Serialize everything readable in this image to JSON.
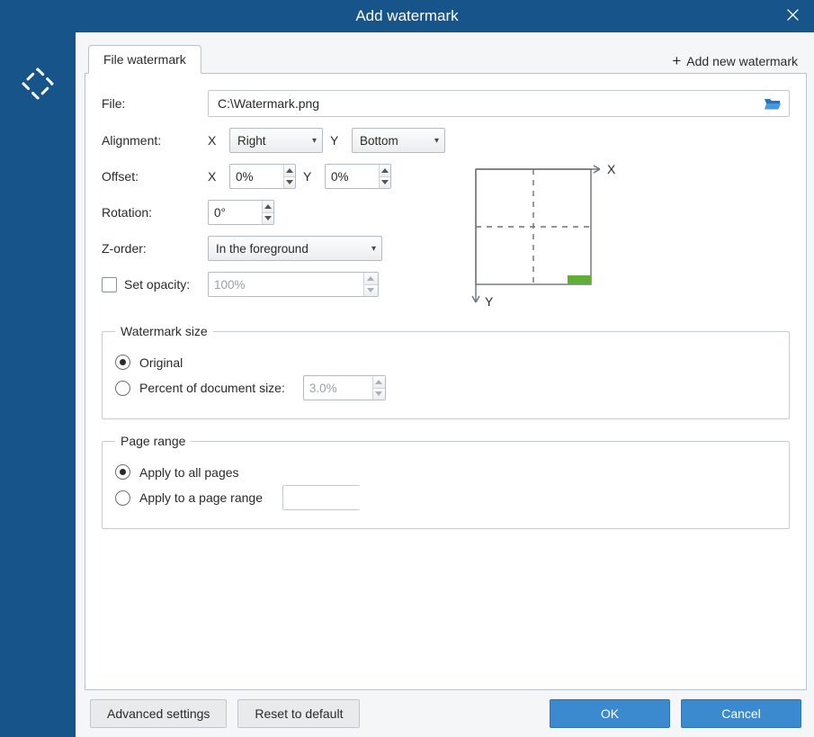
{
  "window": {
    "title": "Add watermark"
  },
  "tabs": {
    "file_watermark": "File watermark",
    "add_new": "Add new watermark"
  },
  "fields": {
    "file_label": "File:",
    "file_value": "C:\\Watermark.png",
    "alignment_label": "Alignment:",
    "axis_x": "X",
    "axis_y": "Y",
    "align_x": "Right",
    "align_y": "Bottom",
    "offset_label": "Offset:",
    "offset_x": "0%",
    "offset_y": "0%",
    "rotation_label": "Rotation:",
    "rotation": "0°",
    "zorder_label": "Z-order:",
    "zorder": "In the foreground",
    "set_opacity_label": "Set opacity:",
    "opacity": "100%"
  },
  "diagram": {
    "x_label": "X",
    "y_label": "Y"
  },
  "watermark_size": {
    "legend": "Watermark size",
    "original": "Original",
    "percent_label": "Percent of document size:",
    "percent_value": "3.0%"
  },
  "page_range": {
    "legend": "Page range",
    "all": "Apply to all pages",
    "range": "Apply to a page range",
    "range_value": ""
  },
  "buttons": {
    "advanced": "Advanced settings",
    "reset": "Reset to default",
    "ok": "OK",
    "cancel": "Cancel"
  }
}
